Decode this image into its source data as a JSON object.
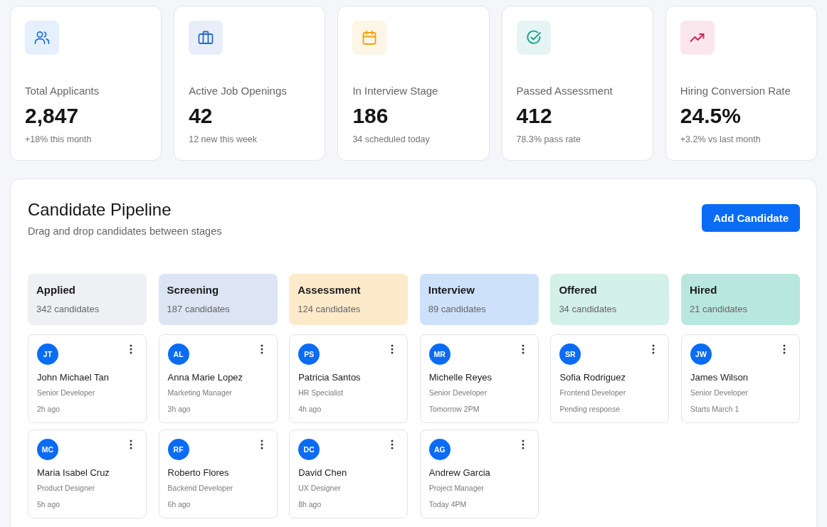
{
  "stats": [
    {
      "kind": "people",
      "color": "#1f74e0",
      "label": "Total Applicants",
      "value": "2,847",
      "note": "+18% this month"
    },
    {
      "kind": "briefcase",
      "color": "#2c68c4",
      "label": "Active Job Openings",
      "value": "42",
      "note": "12 new this week"
    },
    {
      "kind": "calendar",
      "color": "#f0a20e",
      "label": "In Interview Stage",
      "value": "186",
      "note": "34 scheduled today"
    },
    {
      "kind": "check",
      "color": "#17a394",
      "label": "Passed Assessment",
      "value": "412",
      "note": "78.3% pass rate"
    },
    {
      "kind": "trend",
      "color": "#cf2459",
      "label": "Hiring Conversion Rate",
      "value": "24.5%",
      "note": "+3.2% vs last month"
    }
  ],
  "pipeline": {
    "title": "Candidate Pipeline",
    "subtitle": "Drag and drop candidates between stages",
    "add_button": "Add Candidate",
    "stages": [
      {
        "name": "Applied",
        "count": "342 candidates",
        "color": "#eef0f3",
        "candidates": [
          {
            "initials": "JT",
            "name": "John Michael Tan",
            "role": "Senior Developer",
            "time": "2h ago"
          },
          {
            "initials": "MC",
            "name": "Maria Isabel Cruz",
            "role": "Product Designer",
            "time": "5h ago"
          }
        ]
      },
      {
        "name": "Screening",
        "count": "187 candidates",
        "color": "#dbe5f3",
        "candidates": [
          {
            "initials": "AL",
            "name": "Anna Marie Lopez",
            "role": "Marketing Manager",
            "time": "3h ago"
          },
          {
            "initials": "RF",
            "name": "Roberto Flores",
            "role": "Backend Developer",
            "time": "6h ago"
          }
        ]
      },
      {
        "name": "Assessment",
        "count": "124 candidates",
        "color": "#fdeacb",
        "candidates": [
          {
            "initials": "PS",
            "name": "Patricia Santos",
            "role": "HR Specialist",
            "time": "4h ago"
          },
          {
            "initials": "DC",
            "name": "David Chen",
            "role": "UX Designer",
            "time": "8h ago"
          }
        ]
      },
      {
        "name": "Interview",
        "count": "89 candidates",
        "color": "#cde1fb",
        "candidates": [
          {
            "initials": "MR",
            "name": "Michelle Reyes",
            "role": "Senior Developer",
            "time": "Tomorrow 2PM"
          },
          {
            "initials": "AG",
            "name": "Andrew Garcia",
            "role": "Project Manager",
            "time": "Today 4PM"
          }
        ]
      },
      {
        "name": "Offered",
        "count": "34 candidates",
        "color": "#d3f0e9",
        "candidates": [
          {
            "initials": "SR",
            "name": "Sofia Rodriguez",
            "role": "Frontend Developer",
            "time": "Pending response"
          }
        ]
      },
      {
        "name": "Hired",
        "count": "21 candidates",
        "color": "#b8e7de",
        "candidates": [
          {
            "initials": "JW",
            "name": "James Wilson",
            "role": "Senior Developer",
            "time": "Starts March 1"
          }
        ]
      }
    ]
  }
}
